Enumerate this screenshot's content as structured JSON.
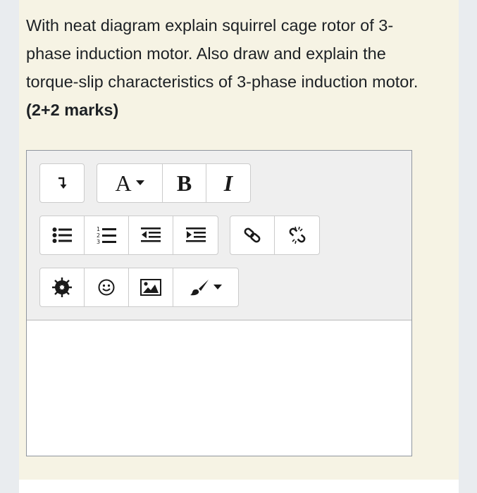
{
  "question": {
    "text": "With neat diagram explain squirrel cage rotor of 3-phase induction motor. Also draw and explain the torque-slip characteristics of 3-phase induction motor.",
    "marks": "(2+2 marks)"
  },
  "toolbar": {
    "bold_label": "B",
    "italic_label": "I",
    "font_label": "A",
    "icons": [
      "toolbar-toggle-icon",
      "font-style-icon",
      "bold-icon",
      "italic-icon",
      "bullet-list-icon",
      "numbered-list-icon",
      "outdent-icon",
      "indent-icon",
      "link-icon",
      "unlink-icon",
      "media-icon",
      "emoji-icon",
      "image-icon",
      "paintbrush-icon"
    ]
  },
  "editor": {
    "content": ""
  },
  "colors": {
    "panel_background": "#f6f3e4",
    "page_background": "#e9ecef",
    "toolbar_background": "#efefef",
    "text": "#1d2125"
  }
}
